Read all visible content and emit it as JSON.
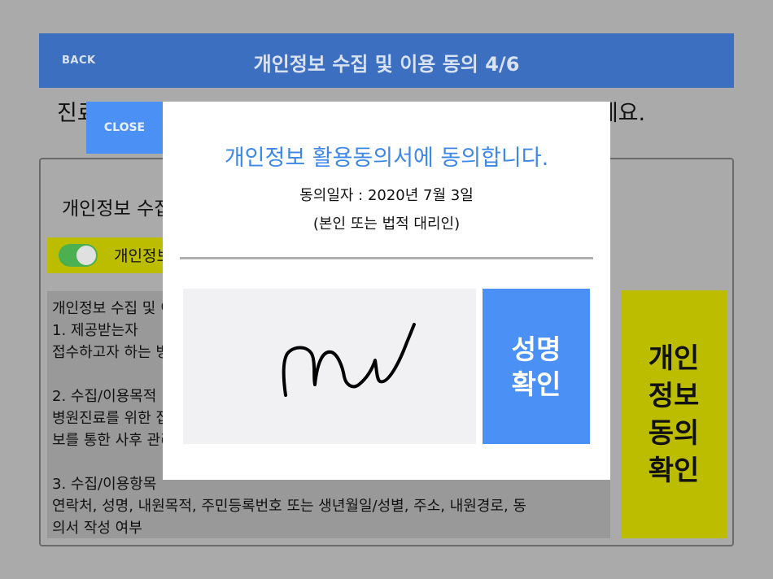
{
  "header": {
    "back_label": "BACK",
    "title": "개인정보 수집 및 이용 동의 4/6"
  },
  "instruction": "진료접수를 위해 개인정보 수집 및 이용 동의서를 작성해 주세요.",
  "section": {
    "title": "개인정보 수집 및 이용 동의",
    "toggle_on": true,
    "agree_label": "개인정보 수집 및 이용에 동의합니다"
  },
  "terms": {
    "text": "개인정보 수집 및 이용 동의\n1. 제공받는자\n접수하고자 하는 병원\n\n2. 수집/이용목적\n병원진료를 위한 접수 및 내원정\n보를 통한 사후 관리\n\n3. 수집/이용항목\n연락처, 성명, 내원목적, 주민등록번호 또는 생년월일/성별, 주소, 내원경로, 동\n의서 작성 여부"
  },
  "confirm_box": {
    "label": "개인\n정보\n동의\n확인"
  },
  "modal": {
    "close_label": "CLOSE",
    "title": "개인정보 활용동의서에 동의합니다.",
    "date_line": "동의일자 : 2020년 7월 3일",
    "role_line": "(본인 또는 법적 대리인)",
    "verify_label": "성명\n확인"
  },
  "colors": {
    "header_bg": "#3d6fc0",
    "accent_blue": "#4a90f5",
    "modal_title": "#3d87e8",
    "highlight_yellow": "#bdbd00",
    "toggle_green": "#4caf50"
  }
}
